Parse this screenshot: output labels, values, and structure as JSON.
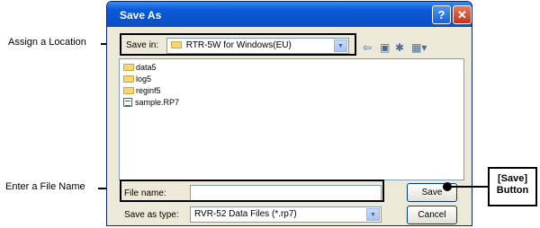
{
  "annotations": {
    "location": "Assign a Location",
    "filename": "Enter a File Name",
    "save_button_line1": "[Save]",
    "save_button_line2": "Button"
  },
  "window": {
    "title": "Save As",
    "help_glyph": "?",
    "close_glyph": "✕"
  },
  "save_in": {
    "label": "Save in:",
    "value": "RTR-5W for Windows(EU)"
  },
  "toolbar_icons": [
    "back-icon",
    "up-folder-icon",
    "new-folder-icon",
    "view-menu-icon"
  ],
  "files": [
    {
      "name": "data5",
      "icon": "folder-icon"
    },
    {
      "name": "log5",
      "icon": "folder-icon"
    },
    {
      "name": "reginf5",
      "icon": "folder-icon"
    },
    {
      "name": "sample.RP7",
      "icon": "file-icon"
    }
  ],
  "file_name": {
    "label": "File name:",
    "value": ""
  },
  "save_as_type": {
    "label": "Save as type:",
    "value": "RVR-52 Data Files (*.rp7)"
  },
  "buttons": {
    "save": "Save",
    "cancel": "Cancel"
  }
}
